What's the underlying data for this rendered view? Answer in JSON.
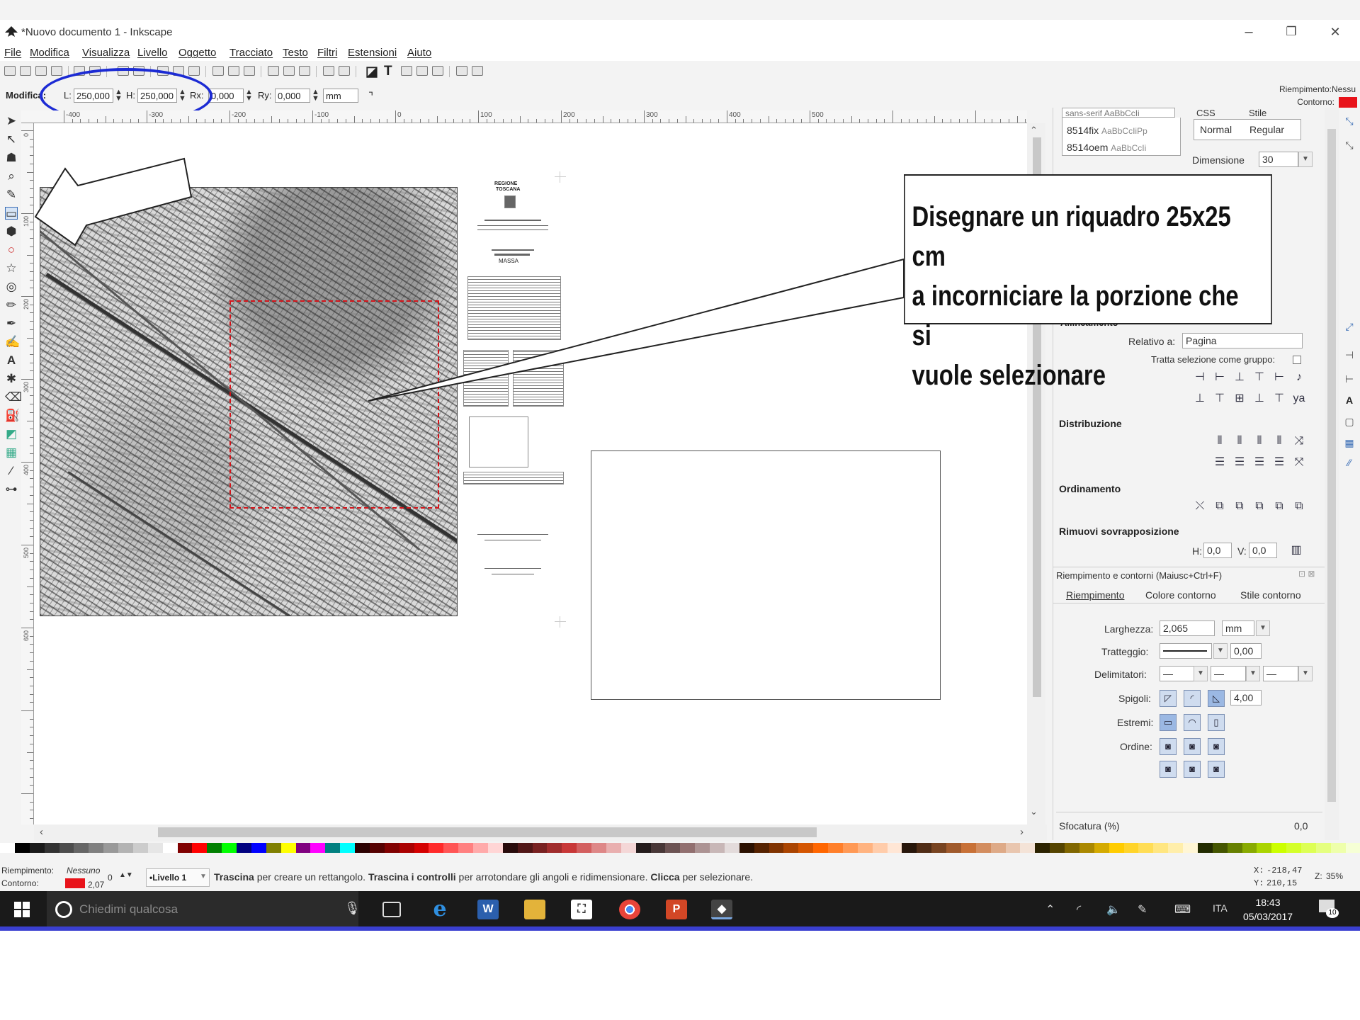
{
  "window": {
    "title": "*Nuovo documento 1 - Inkscape",
    "minimize": "–",
    "maximize": "❐",
    "close": "✕"
  },
  "menu": [
    "File",
    "Modifica",
    "Visualizza",
    "Livello",
    "Oggetto",
    "Tracciato",
    "Testo",
    "Filtri",
    "Estensioni",
    "Aiuto"
  ],
  "tool_controls": {
    "label": "Modifica:",
    "w_label": "L:",
    "w_value": "250,000",
    "h_label": "H:",
    "h_value": "250,000",
    "rx_label": "Rx:",
    "rx_value": "0,000",
    "ry_label": "Ry:",
    "ry_value": "0,000",
    "unit": "mm"
  },
  "fill_stroke_indicator": {
    "fill_label": "Riempimento:",
    "fill_value": "Nessu",
    "stroke_label": "Contorno:",
    "stroke_color": "#e8131a"
  },
  "ruler": {
    "h_labels": [
      "-400",
      "-300",
      "-200",
      "-100",
      "0",
      "100",
      "200",
      "300",
      "400",
      "500"
    ],
    "v_labels": [
      "0",
      "100",
      "200",
      "300",
      "400",
      "500",
      "600"
    ]
  },
  "dock": {
    "text_panel": {
      "fonts": [
        {
          "name": "sans-serif",
          "sample": "AaBbCcIi"
        },
        {
          "name": "8514fix",
          "sample": "AaBbCcIiPp"
        },
        {
          "name": "8514oem",
          "sample": "AaBbCcIi"
        }
      ],
      "css_label": "CSS",
      "style_label": "Stile",
      "style_normal": "Normal",
      "style_regular": "Regular",
      "size_label": "Dimensione",
      "size_value": "30"
    },
    "align": {
      "header": "Allineamento",
      "relative_label": "Relativo a:",
      "relative_value": "Pagina",
      "group_label": "Tratta selezione come gruppo:"
    },
    "distribute_header": "Distribuzione",
    "order_header": "Ordinamento",
    "overlap": {
      "header": "Rimuovi sovrapposizione",
      "h_label": "H:",
      "h_value": "0,0",
      "v_label": "V:",
      "v_value": "0,0"
    },
    "fill_stroke": {
      "title": "Riempimento e contorni (Maiusc+Ctrl+F)",
      "tab_fill": "Riempimento",
      "tab_stroke_paint": "Colore contorno",
      "tab_stroke_style": "Stile contorno",
      "width_label": "Larghezza:",
      "width_value": "2,065",
      "width_unit": "mm",
      "dash_label": "Tratteggio:",
      "dash_value": "0,00",
      "markers_label": "Delimitatori:",
      "join_label": "Spigoli:",
      "join_value": "4,00",
      "caps_label": "Estremi:",
      "order_label": "Ordine:",
      "blur_label": "Sfocatura (%)",
      "blur_value": "0,0"
    }
  },
  "status": {
    "fill_label": "Riempimento:",
    "fill_value": "Nessuno",
    "stroke_label": "Contorno:",
    "stroke_width": "2,07",
    "opacity_value": "0",
    "layer": "•Livello 1",
    "msg_b1": "Trascina",
    "msg_t1": " per creare un rettangolo. ",
    "msg_b2": "Trascina i controlli",
    "msg_t2": " per arrotondare gli angoli e ridimensionare. ",
    "msg_b3": "Clicca",
    "msg_t3": " per selezionare.",
    "x_label": "X:",
    "x_value": "-218,47",
    "y_label": "Y:",
    "y_value": "210,15",
    "zoom_label": "Z:",
    "zoom_value": "35%"
  },
  "taskbar": {
    "search_placeholder": "Chiedimi qualcosa",
    "language": "ITA",
    "time": "18:43",
    "date": "05/03/2017",
    "notifications": "10"
  },
  "callout": {
    "line1": "Disegnare un riquadro 25x25 cm",
    "line2": "a incorniciare la porzione che si",
    "line3": "vuole selezionare"
  },
  "map_legend": {
    "line1": "REGIONE",
    "line2": "TOSCANA",
    "place": "MASSA"
  },
  "colors": {
    "accent_blue": "#1c2bd4",
    "selection_red": "#d4141a",
    "taskbar": "#1a1a1a"
  }
}
